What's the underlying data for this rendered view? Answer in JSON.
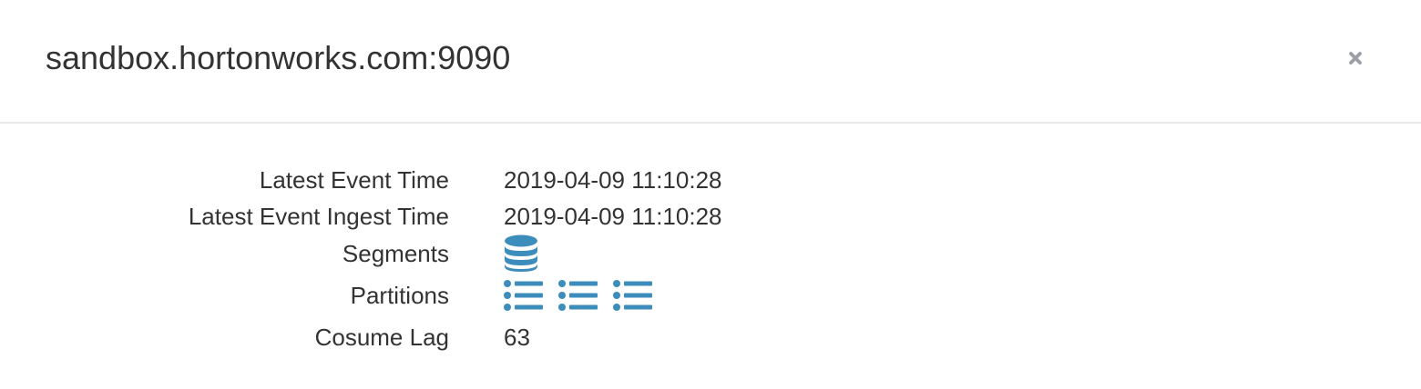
{
  "modal": {
    "title": "sandbox.hortonworks.com:9090",
    "close_icon": "close-icon"
  },
  "details": {
    "latest_event_time": {
      "label": "Latest Event Time",
      "value": "2019-04-09 11:10:28"
    },
    "latest_event_ingest_time": {
      "label": "Latest Event Ingest Time",
      "value": "2019-04-09 11:10:28"
    },
    "segments": {
      "label": "Segments",
      "icon": "database-icon"
    },
    "partitions": {
      "label": "Partitions",
      "icon": "list-icon",
      "count": 3
    },
    "consume_lag": {
      "label": "Cosume Lag",
      "value": "63"
    }
  },
  "colors": {
    "icon_blue": "#3c8dbc",
    "close_gray": "#9aa3ac",
    "text": "#333333",
    "divider": "#e8e8e8"
  }
}
